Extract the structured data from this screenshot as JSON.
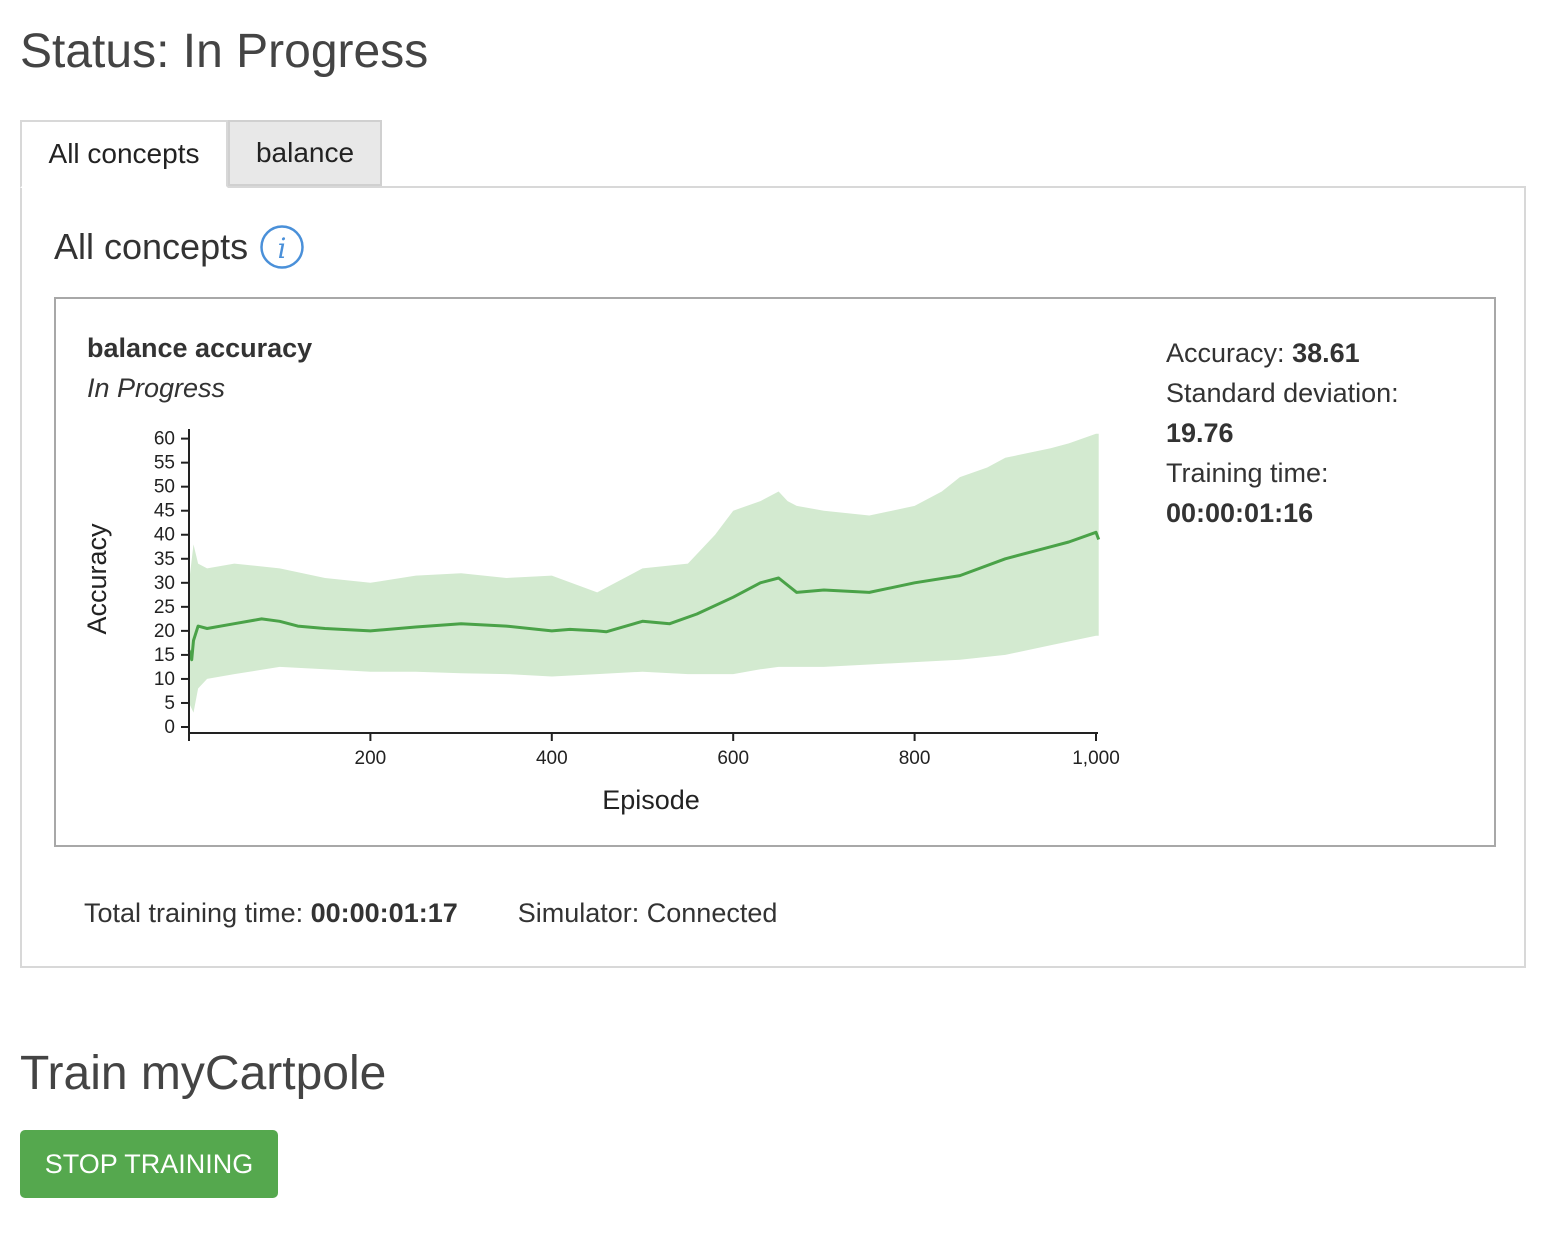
{
  "status": {
    "title": "Status: In Progress"
  },
  "tabs": [
    {
      "label": "All concepts",
      "active": true
    },
    {
      "label": "balance",
      "active": false
    }
  ],
  "panel": {
    "heading": "All concepts",
    "info_icon": "info-icon"
  },
  "card": {
    "title": "balance accuracy",
    "subtitle": "In Progress",
    "stats": {
      "accuracy_label": "Accuracy:",
      "accuracy_value": "38.61",
      "std_label": "Standard deviation:",
      "std_value": "19.76",
      "time_label": "Training time:",
      "time_value": "00:00:01:16"
    }
  },
  "chart_data": {
    "type": "area",
    "xlabel": "Episode",
    "ylabel": "Accuracy",
    "xlim": [
      0,
      1000
    ],
    "ylim": [
      0,
      62
    ],
    "x_ticks": [
      200,
      400,
      600,
      800,
      1000
    ],
    "x_tick_labels": [
      "200",
      "400",
      "600",
      "800",
      "1,000"
    ],
    "y_ticks": [
      0,
      5,
      10,
      15,
      20,
      25,
      30,
      35,
      40,
      45,
      50,
      55,
      60
    ],
    "grid": false,
    "colors": {
      "line": "#4aa248",
      "band": "#d3ead0"
    },
    "series": [
      {
        "values_type": "mean",
        "x": [
          0,
          3,
          5,
          10,
          20,
          50,
          80,
          100,
          120,
          150,
          200,
          250,
          300,
          350,
          400,
          420,
          450,
          460,
          500,
          530,
          560,
          600,
          630,
          650,
          670,
          700,
          750,
          800,
          850,
          900,
          950,
          970,
          1000,
          1003
        ],
        "y": [
          16,
          14,
          18,
          21,
          20.5,
          21.5,
          22.5,
          22,
          21,
          20.5,
          20,
          20.8,
          21.5,
          21,
          20,
          20.3,
          20,
          19.8,
          22,
          21.5,
          23.5,
          27,
          30,
          31,
          28,
          28.5,
          28,
          30,
          31.5,
          35,
          37.5,
          38.5,
          40.5,
          39
        ]
      },
      {
        "values_type": "upper",
        "x": [
          0,
          5,
          10,
          20,
          50,
          100,
          150,
          200,
          250,
          300,
          350,
          400,
          450,
          460,
          500,
          550,
          580,
          600,
          630,
          650,
          660,
          670,
          700,
          750,
          800,
          830,
          850,
          880,
          900,
          950,
          970,
          1000,
          1003
        ],
        "y": [
          30,
          38,
          34,
          33,
          34,
          33,
          31,
          30,
          31.5,
          32,
          31,
          31.5,
          28,
          29,
          33,
          34,
          40,
          45,
          47,
          49,
          47,
          46,
          45,
          44,
          46,
          49,
          52,
          54,
          56,
          58,
          59,
          61,
          61
        ]
      },
      {
        "values_type": "lower",
        "x": [
          0,
          5,
          10,
          20,
          50,
          100,
          150,
          200,
          250,
          300,
          350,
          400,
          450,
          500,
          550,
          600,
          630,
          650,
          700,
          750,
          800,
          850,
          900,
          950,
          1000,
          1003
        ],
        "y": [
          5,
          3,
          8,
          10,
          11,
          12.5,
          12,
          11.5,
          11.5,
          11.2,
          11,
          10.5,
          11,
          11.5,
          11,
          11,
          12,
          12.5,
          12.5,
          13,
          13.5,
          14,
          15,
          17,
          19,
          19
        ]
      }
    ]
  },
  "footer": {
    "total_label": "Total training time:",
    "total_value": "00:00:01:17",
    "simulator_text": "Simulator: Connected"
  },
  "train": {
    "title": "Train myCartpole",
    "stop_label": "STOP TRAINING"
  },
  "colors": {
    "accent_green": "#55a84e",
    "info_blue": "#4a90d9"
  }
}
